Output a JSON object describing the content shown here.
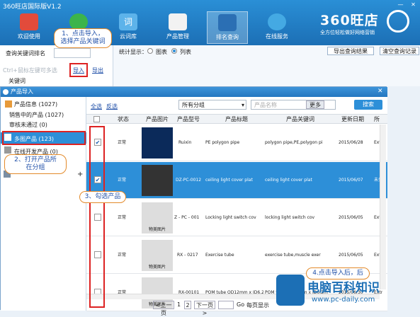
{
  "app": {
    "title": "360旺店国际版V1.2",
    "min": "—",
    "close": "✕"
  },
  "nav": [
    {
      "label": "欢迎使用",
      "color": "#e24b3b"
    },
    {
      "label": "",
      "color": "#3cb44b"
    },
    {
      "label": "云词库",
      "color": "#5db3ea"
    },
    {
      "label": "产品管理",
      "color": "#f2f2f2"
    },
    {
      "label": "排名查询",
      "color": "#2b6fb4"
    },
    {
      "label": "在线服务",
      "color": "#44a9e3"
    }
  ],
  "brand": {
    "name": "360旺店",
    "slogan": "全方位轻松做好网络营销"
  },
  "left": {
    "query_label": "查询关键词排名",
    "hint": "Ctrl+鼠标左键可多选",
    "keyword": "关键词",
    "import": "导入",
    "export": "导出"
  },
  "right": {
    "stat_label": "统计显示：",
    "opt_chart": "图表",
    "opt_list": "列表",
    "export_btn": "导出查询结果",
    "clear_btn": "清空查询记录"
  },
  "dialog": {
    "title": "产品导入",
    "select_all": "全选",
    "invert": "反选",
    "group": "所有分组",
    "search_ph": "产品名称",
    "more": "更多",
    "search_btn": "搜索"
  },
  "tree": {
    "root": "产品信息 (1027)",
    "on_sale": "销售中的产品 (1027)",
    "unapproved": "审核未通过 (0)",
    "multi": "多图产品 (123)",
    "dev": "在线开发产品 (0)"
  },
  "cols": {
    "status": "状态",
    "image": "产品图片",
    "model": "产品型号",
    "title": "产品标题",
    "keyword": "产品关键词",
    "date": "更新日期",
    "extra": "所"
  },
  "rows": [
    {
      "checked": "✔",
      "status": "正常",
      "model": "Ruixin",
      "title": "PE polygon pipe",
      "kw": "polygon pipe,PE,polygon pi",
      "date": "2015/06/28",
      "extra": "Extr"
    },
    {
      "checked": "✔",
      "status": "正常",
      "model": "DZ-PC-0012",
      "title": "ceiling light cover plat",
      "kw": "ceiling light cover plat",
      "date": "2015/06/07",
      "extra": "未分"
    },
    {
      "checked": "",
      "status": "正常",
      "model": "Z - PC - 001",
      "title": "Locking light switch cov",
      "kw": "locking light switch cov",
      "date": "2015/06/05",
      "extra": "Extr"
    },
    {
      "checked": "",
      "status": "正常",
      "model": "RX - 0217",
      "title": "Exercise tube",
      "kw": "exercise tube,muscle exer",
      "date": "2015/06/05",
      "extra": "Extr"
    },
    {
      "checked": "",
      "status": "正常",
      "model": "RX-00101",
      "title": "POM tube OD12mm x ID6.2m",
      "kw": "POM tube OD12mm x ID6.2m",
      "date": "2015/06/30",
      "extra": "Extr"
    }
  ],
  "pager": {
    "prev": "<上一页",
    "p1": "1",
    "p2": "2",
    "next": "下一页>",
    "go": "Go",
    "per": "每页显示"
  },
  "callouts": {
    "c1": "1、点击导入，\n选择产品关键词",
    "c2": "2、打开产品所\n在分组",
    "c3": "3、勾选产品",
    "c4": "4.点击导入后，后"
  },
  "wm": {
    "name": "电脑百科知识",
    "url": "www.pc-daily.com",
    "tag": "物美图片"
  },
  "colors": {
    "accent": "#2d8fd8",
    "callout_text": "#1f4fa8",
    "red": "#d22"
  }
}
